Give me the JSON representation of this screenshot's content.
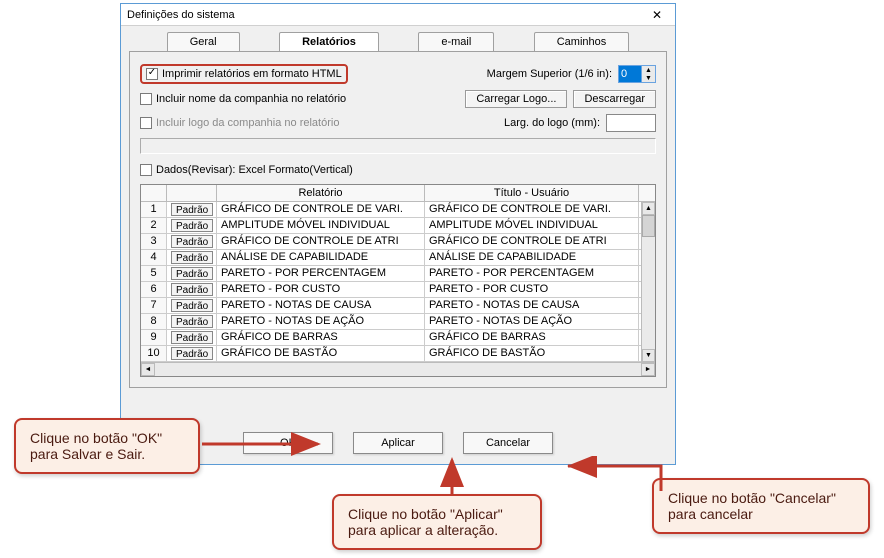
{
  "dialog": {
    "title": "Definições do sistema",
    "tabs": [
      "Geral",
      "Relatórios",
      "e-mail",
      "Caminhos"
    ],
    "active_tab": "Relatórios",
    "report_tab": {
      "print_html_label": "Imprimir relatórios em formato HTML",
      "print_html_checked": true,
      "include_company_name_label": "Incluir nome da companhia no relatório",
      "include_company_name_checked": false,
      "include_company_logo_label": "Incluir logo da companhia no relatório",
      "include_company_logo_checked": false,
      "top_margin_label": "Margem Superior (1/6 in):",
      "top_margin_value": "0",
      "load_logo_btn": "Carregar Logo...",
      "unload_logo_btn": "Descarregar",
      "logo_width_label": "Larg. do logo (mm):",
      "logo_width_value": "",
      "review_data_label": "Dados(Revisar): Excel Formato(Vertical)",
      "review_data_checked": false,
      "table": {
        "col_btn": "",
        "col_report": "Relatório",
        "col_title": "Título - Usuário",
        "default_btn_label": "Padrão",
        "rows": [
          {
            "n": "1",
            "report": "GRÁFICO DE CONTROLE DE VARI.",
            "title": "GRÁFICO DE CONTROLE DE VARI."
          },
          {
            "n": "2",
            "report": "AMPLITUDE MÓVEL INDIVIDUAL",
            "title": "AMPLITUDE MÓVEL INDIVIDUAL"
          },
          {
            "n": "3",
            "report": "GRÁFICO DE CONTROLE DE ATRI",
            "title": "GRÁFICO DE CONTROLE DE ATRI"
          },
          {
            "n": "4",
            "report": "ANÁLISE DE CAPABILIDADE",
            "title": "ANÁLISE DE CAPABILIDADE"
          },
          {
            "n": "5",
            "report": "PARETO - POR PERCENTAGEM",
            "title": "PARETO - POR PERCENTAGEM"
          },
          {
            "n": "6",
            "report": "PARETO - POR CUSTO",
            "title": "PARETO - POR CUSTO"
          },
          {
            "n": "7",
            "report": "PARETO - NOTAS DE CAUSA",
            "title": "PARETO - NOTAS DE CAUSA"
          },
          {
            "n": "8",
            "report": "PARETO - NOTAS DE AÇÃO",
            "title": "PARETO - NOTAS DE AÇÃO"
          },
          {
            "n": "9",
            "report": "GRÁFICO DE BARRAS",
            "title": "GRÁFICO DE BARRAS"
          },
          {
            "n": "10",
            "report": "GRÁFICO DE BASTÃO",
            "title": "GRÁFICO DE BASTÃO"
          }
        ]
      }
    },
    "buttons": {
      "ok": "OK",
      "apply": "Aplicar",
      "cancel": "Cancelar"
    }
  },
  "callouts": {
    "ok": {
      "line1": "Clique no botão \"OK\"",
      "line2": "para Salvar e Sair."
    },
    "apply": {
      "line1": "Clique no botão \"Aplicar\"",
      "line2": "para aplicar a alteração."
    },
    "cancel": {
      "line1": "Clique no botão \"Cancelar\"",
      "line2": "para cancelar"
    }
  }
}
